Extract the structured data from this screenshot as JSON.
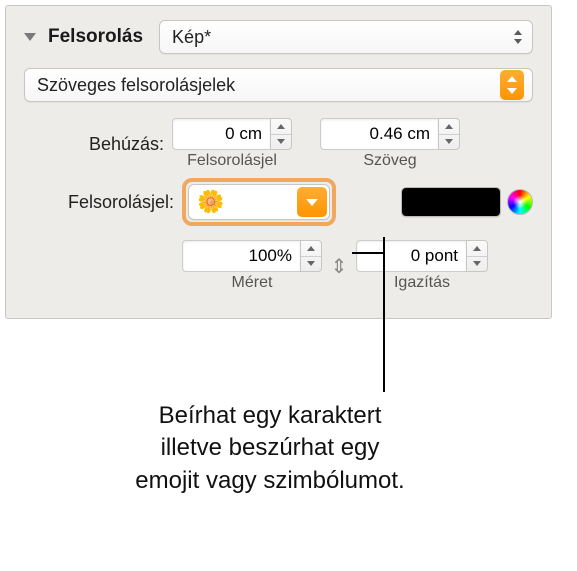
{
  "header": {
    "title": "Felsorolás",
    "popup_value": "Kép*"
  },
  "bullet_type": {
    "value": "Szöveges felsorolásjelek"
  },
  "indent": {
    "label": "Behúzás:",
    "bullet_value": "0 cm",
    "bullet_sublabel": "Felsorolásjel",
    "text_value": "0.46 cm",
    "text_sublabel": "Szöveg"
  },
  "symbol": {
    "label": "Felsorolásjel:",
    "emoji": "🌼",
    "color_hex": "#000000"
  },
  "size": {
    "value": "100%",
    "label": "Méret"
  },
  "align": {
    "value": "0 pont",
    "label": "Igazítás"
  },
  "caption": {
    "line1": "Beírhat egy karaktert",
    "line2": "illetve beszúrhat egy",
    "line3": "emojit vagy szimbólumot."
  }
}
